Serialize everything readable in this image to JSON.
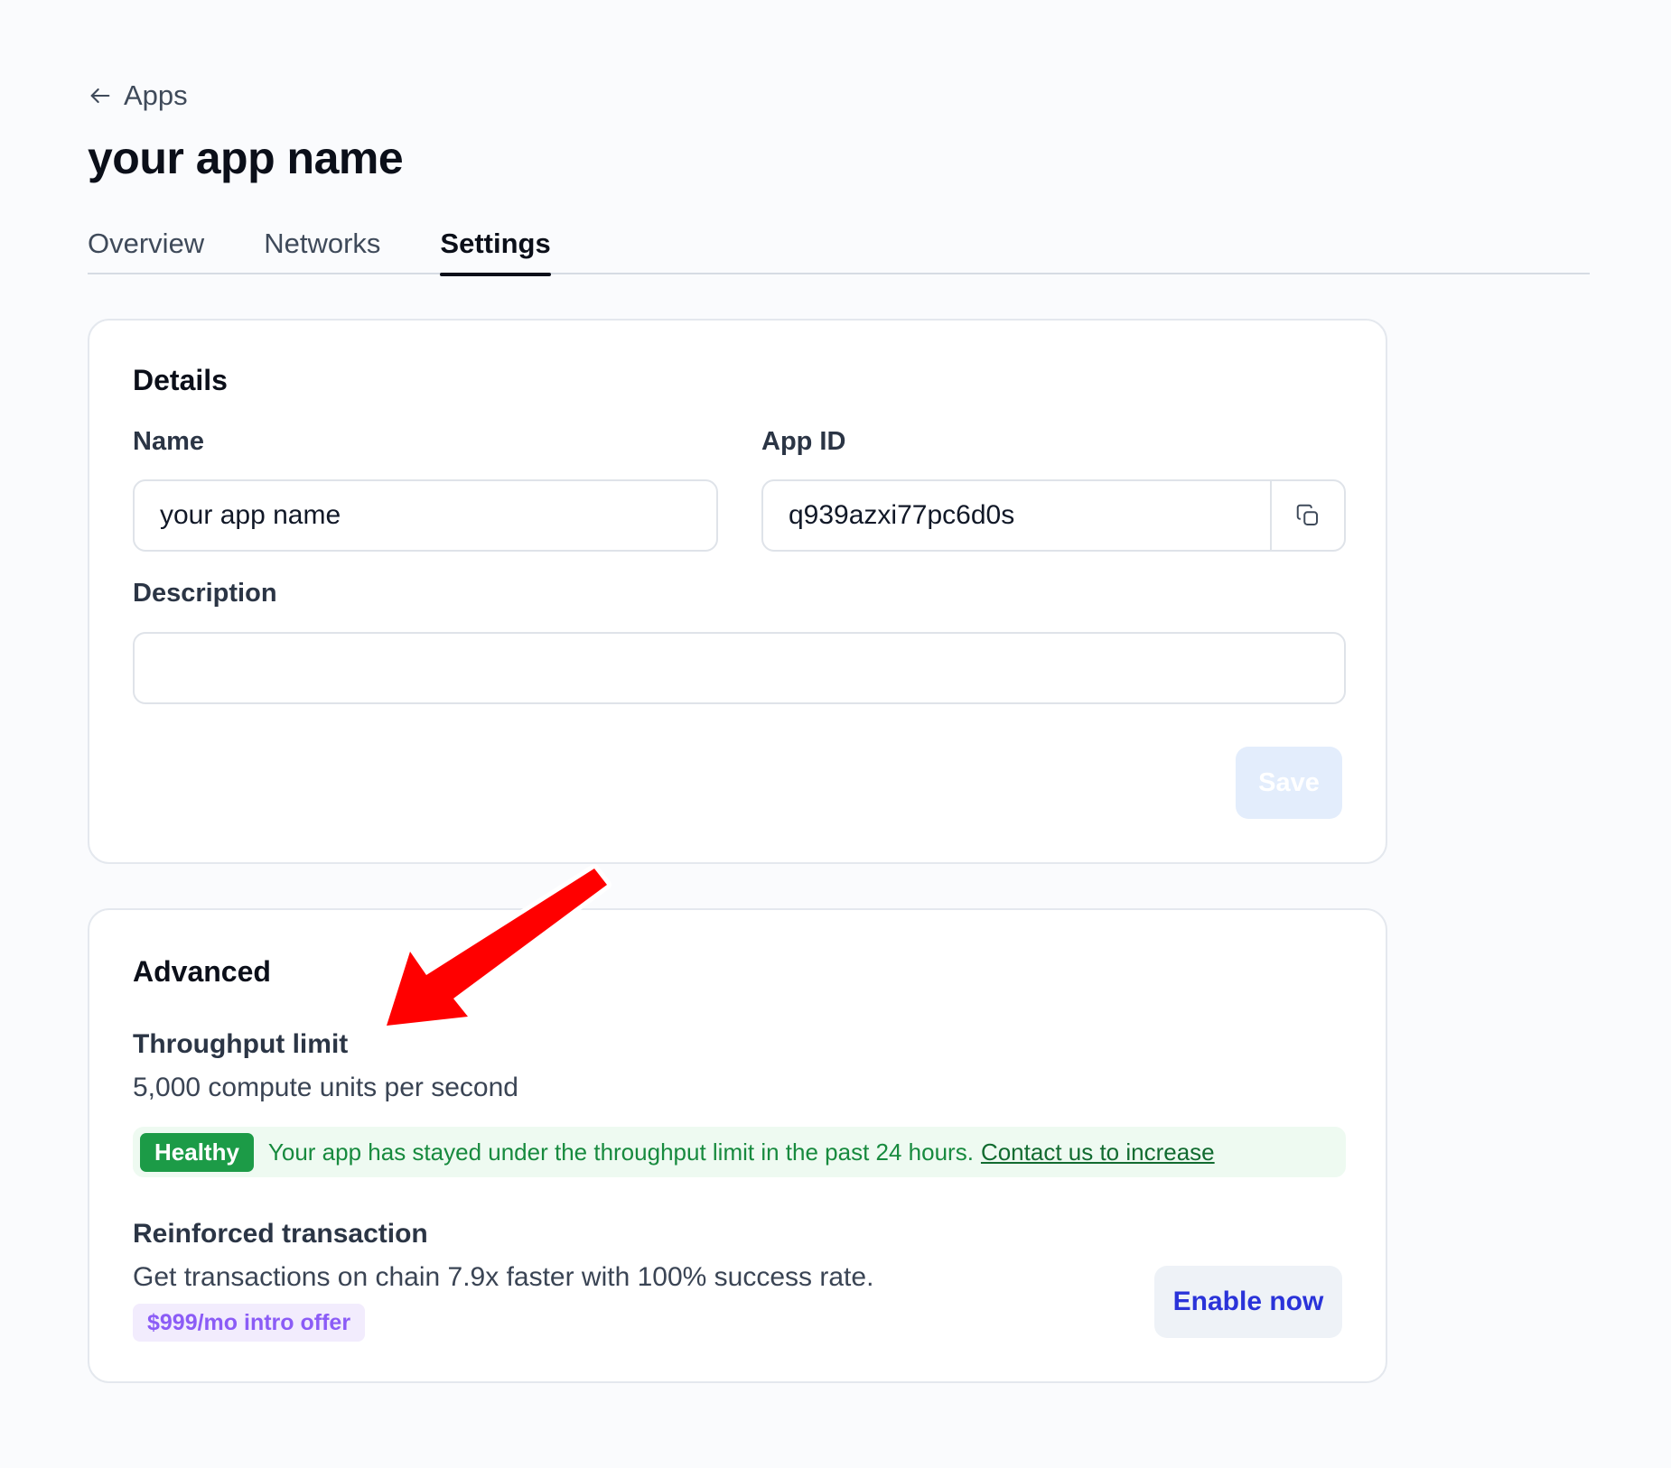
{
  "header": {
    "back_label": "Apps",
    "title": "your app name"
  },
  "tabs": [
    {
      "label": "Overview",
      "active": false
    },
    {
      "label": "Networks",
      "active": false
    },
    {
      "label": "Settings",
      "active": true
    }
  ],
  "details": {
    "title": "Details",
    "name_label": "Name",
    "name_value": "your app name",
    "appid_label": "App ID",
    "appid_value": "q939azxi77pc6d0s",
    "description_label": "Description",
    "description_value": "",
    "save_label": "Save"
  },
  "advanced": {
    "title": "Advanced",
    "throughput_label": "Throughput limit",
    "throughput_value": "5,000 compute units per second",
    "status_badge": "Healthy",
    "status_text": "Your app has stayed under the throughput limit in the past 24 hours.",
    "status_link": "Contact us to increase",
    "reinforced_label": "Reinforced transaction",
    "reinforced_text": "Get transactions on chain 7.9x faster with 100% success rate.",
    "offer_badge": "$999/mo intro offer",
    "enable_label": "Enable now"
  },
  "icons": {
    "back": "arrow-left-icon",
    "copy": "copy-icon",
    "annotation": "red-arrow-annotation"
  },
  "colors": {
    "healthy": "#1c9b47",
    "link_blue": "#2a33d9",
    "offer_purple": "#8b5cf6",
    "annotation_red": "#ff0000"
  }
}
